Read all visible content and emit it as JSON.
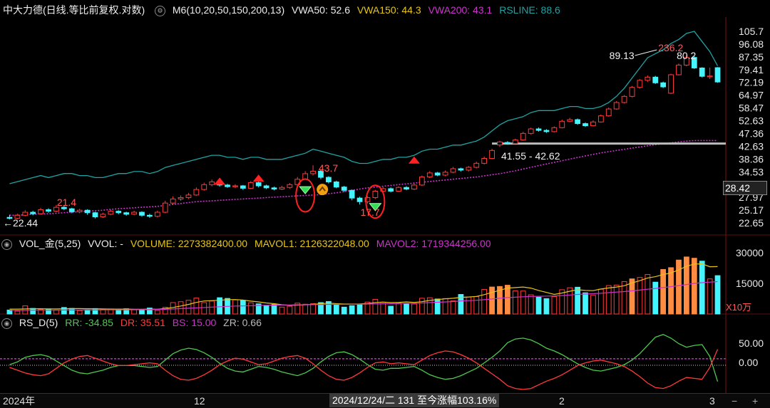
{
  "main": {
    "title": "中大力德(日线.等比前复权.对数)",
    "ma_label": "M6(10,20,50,150,200,13)",
    "vwa50": "VWA50: 52.6",
    "vwa150": "VWA150: 44.3",
    "vwa200": "VWA200: 43.1",
    "rsline": "RSLINE: 88.6",
    "price_ticks": [
      "105.7",
      "96.08",
      "87.35",
      "79.41",
      "72.19",
      "64.97",
      "58.47",
      "52.63",
      "47.36",
      "42.63",
      "38.36",
      "34.53",
      "31.07",
      "27.97",
      "25.17",
      "22.65"
    ],
    "current_price": "28.42",
    "annotations": {
      "low_start": "22.44",
      "a1": "21.4",
      "a2": "43.7",
      "a3": "17.7",
      "zone": "41.55 - 42.62",
      "hi1": "89.13",
      "hi2": "236.2",
      "hi3": "80.2"
    }
  },
  "volume": {
    "title": "VOL_金(5,25)",
    "vvol": "VVOL: -",
    "volume": "VOLUME: 2273382400.00",
    "mavol1": "MAVOL1: 2126322048.00",
    "mavol2": "MAVOL2: 1719344256.00",
    "ticks": [
      "30000",
      "15000"
    ],
    "unit": "X10万"
  },
  "rsd": {
    "title": "RS_D(5)",
    "rr": "RR: -34.85",
    "dr": "DR: 35.51",
    "bs": "BS: 15.00",
    "zr": "ZR: 0.66",
    "ticks": [
      "50.00",
      "0.00"
    ]
  },
  "xaxis": {
    "labels": [
      "2024年",
      "12",
      "2",
      "3"
    ],
    "date_info": "2024/12/24/二 131 至今涨幅103.16%",
    "zoom_minus": "−",
    "zoom_plus": "+"
  },
  "colors": {
    "up": "#ff3b3b",
    "down": "#44f4ff",
    "rsline": "#1fa3a3",
    "vwa": "#cc33cc",
    "yellow": "#e6c619",
    "green": "#4ec94e"
  },
  "chart_data": [
    {
      "type": "candlestick",
      "title": "中大力德(日线.等比前复权.对数)",
      "yscale": "log",
      "ylim": [
        21.5,
        112
      ],
      "candles": [
        [
          22.4,
          22.2,
          22.9,
          22.0
        ],
        [
          22.2,
          22.8,
          23.1,
          22.0
        ],
        [
          22.8,
          23.4,
          23.8,
          22.6
        ],
        [
          23.4,
          23.1,
          23.7,
          22.8
        ],
        [
          23.1,
          23.9,
          24.3,
          22.9
        ],
        [
          23.9,
          23.6,
          24.2,
          23.3
        ],
        [
          23.6,
          24.4,
          24.9,
          23.4
        ],
        [
          24.4,
          24.1,
          24.7,
          23.8
        ],
        [
          24.1,
          23.5,
          24.3,
          23.2
        ],
        [
          23.5,
          23.8,
          24.1,
          23.2
        ],
        [
          23.8,
          23.3,
          24.0,
          22.9
        ],
        [
          23.3,
          22.5,
          23.5,
          22.2
        ],
        [
          22.5,
          23.0,
          23.3,
          22.3
        ],
        [
          23.0,
          23.6,
          23.9,
          22.8
        ],
        [
          23.6,
          23.3,
          23.8,
          23.0
        ],
        [
          23.3,
          23.0,
          23.5,
          22.7
        ],
        [
          23.0,
          23.4,
          23.7,
          22.8
        ],
        [
          23.4,
          22.8,
          23.6,
          22.5
        ],
        [
          22.8,
          22.6,
          23.1,
          22.3
        ],
        [
          22.6,
          23.4,
          23.7,
          22.4
        ],
        [
          23.4,
          25.3,
          25.8,
          23.2
        ],
        [
          25.3,
          26.2,
          26.8,
          25.0
        ],
        [
          26.2,
          26.5,
          27.0,
          25.8
        ],
        [
          26.5,
          27.1,
          27.6,
          26.2
        ],
        [
          27.1,
          28.4,
          28.9,
          26.9
        ],
        [
          28.4,
          29.6,
          30.1,
          28.1
        ],
        [
          29.6,
          30.3,
          30.9,
          29.2
        ],
        [
          30.3,
          29.5,
          30.6,
          29.1
        ],
        [
          29.5,
          29.1,
          29.8,
          28.8
        ],
        [
          29.1,
          29.3,
          29.7,
          28.7
        ],
        [
          29.3,
          28.7,
          29.5,
          28.3
        ],
        [
          28.7,
          30.1,
          30.5,
          28.5
        ],
        [
          30.1,
          29.3,
          30.4,
          28.9
        ],
        [
          29.3,
          28.8,
          29.6,
          28.5
        ],
        [
          28.8,
          28.5,
          29.1,
          28.2
        ],
        [
          28.5,
          28.9,
          29.3,
          28.3
        ],
        [
          28.9,
          29.6,
          30.0,
          28.6
        ],
        [
          29.6,
          31.0,
          31.6,
          29.3
        ],
        [
          31.0,
          32.5,
          33.2,
          30.8
        ],
        [
          32.5,
          33.2,
          34.9,
          32.0
        ],
        [
          33.2,
          31.5,
          33.5,
          31.0
        ],
        [
          31.5,
          30.3,
          31.8,
          29.9
        ],
        [
          30.3,
          29.0,
          30.6,
          28.7
        ],
        [
          29.0,
          28.2,
          29.3,
          27.8
        ],
        [
          28.2,
          26.4,
          28.4,
          25.9
        ],
        [
          26.4,
          25.6,
          26.7,
          25.0
        ],
        [
          25.6,
          26.5,
          26.8,
          25.2
        ],
        [
          26.5,
          28.0,
          28.3,
          26.2
        ],
        [
          28.0,
          28.6,
          29.0,
          27.7
        ],
        [
          28.6,
          28.0,
          28.9,
          27.7
        ],
        [
          28.0,
          28.9,
          29.2,
          27.8
        ],
        [
          28.9,
          28.5,
          29.2,
          28.2
        ],
        [
          28.5,
          29.5,
          30.0,
          28.3
        ],
        [
          29.5,
          31.6,
          32.0,
          29.3
        ],
        [
          31.6,
          32.7,
          33.2,
          31.3
        ],
        [
          32.7,
          32.1,
          33.0,
          31.8
        ],
        [
          32.1,
          32.9,
          33.4,
          31.8
        ],
        [
          32.9,
          33.9,
          34.4,
          32.6
        ],
        [
          33.9,
          33.5,
          34.2,
          33.1
        ],
        [
          33.5,
          34.3,
          34.7,
          33.1
        ],
        [
          34.3,
          35.5,
          36.0,
          34.0
        ],
        [
          35.5,
          37.0,
          37.6,
          35.2
        ],
        [
          37.0,
          39.6,
          40.2,
          36.8
        ],
        [
          41.5,
          42.6,
          43.0,
          40.8
        ],
        [
          42.4,
          42.0,
          42.9,
          41.6
        ],
        [
          42.0,
          43.3,
          43.8,
          41.8
        ],
        [
          43.3,
          45.8,
          46.4,
          43.0
        ],
        [
          45.8,
          47.6,
          48.1,
          45.4
        ],
        [
          47.6,
          47.0,
          48.2,
          46.5
        ],
        [
          47.0,
          46.5,
          47.5,
          46.0
        ],
        [
          46.5,
          48.1,
          48.6,
          46.2
        ],
        [
          48.1,
          50.8,
          51.5,
          47.8
        ],
        [
          50.8,
          51.5,
          52.3,
          50.4
        ],
        [
          51.5,
          49.8,
          52.0,
          49.3
        ],
        [
          49.8,
          48.9,
          50.3,
          48.4
        ],
        [
          48.9,
          50.5,
          51.2,
          48.6
        ],
        [
          50.5,
          53.2,
          53.8,
          50.2
        ],
        [
          53.2,
          56.4,
          57.1,
          52.8
        ],
        [
          56.4,
          59.6,
          60.3,
          56.0
        ],
        [
          59.6,
          62.8,
          63.5,
          59.1
        ],
        [
          62.8,
          67.8,
          68.6,
          62.3
        ],
        [
          67.8,
          72.0,
          72.8,
          67.1
        ],
        [
          72.0,
          74.0,
          75.0,
          71.0
        ],
        [
          74.0,
          70.5,
          74.8,
          69.8
        ],
        [
          70.5,
          68.1,
          71.2,
          67.4
        ],
        [
          64.5,
          75.5,
          76.2,
          64.0
        ],
        [
          75.5,
          82.0,
          83.0,
          75.0
        ],
        [
          82.0,
          87.5,
          89.1,
          81.2
        ],
        [
          87.5,
          80.0,
          88.5,
          79.3
        ],
        [
          80.0,
          74.5,
          80.5,
          73.8
        ],
        [
          74.5,
          74.7,
          80.2,
          72.8
        ],
        [
          80.2,
          71.0,
          80.6,
          70.5
        ]
      ],
      "vwa_series": [
        22.8,
        22.8,
        22.9,
        23.0,
        23.1,
        23.1,
        23.2,
        23.3,
        23.4,
        23.5,
        23.6,
        23.7,
        23.8,
        24.0,
        24.1,
        24.2,
        24.3,
        24.4,
        24.5,
        24.6,
        24.8,
        25.0,
        25.2,
        25.4,
        25.6,
        25.7,
        25.8,
        25.9,
        26.0,
        26.1,
        26.2,
        26.3,
        26.4,
        26.5,
        26.6,
        26.7,
        26.8,
        26.9,
        27.0,
        27.1,
        27.2,
        27.4,
        27.6,
        27.9,
        28.2,
        28.5,
        28.8,
        29.0,
        29.2,
        29.4,
        29.6,
        29.8,
        30.0,
        30.2,
        30.4,
        30.6,
        30.8,
        31.0,
        31.2,
        31.4,
        31.6,
        31.9,
        32.2,
        32.5,
        32.9,
        33.3,
        33.8,
        34.3,
        34.8,
        35.3,
        35.8,
        36.3,
        36.8,
        37.3,
        37.8,
        38.3,
        38.8,
        39.2,
        39.6,
        40.0,
        40.4,
        40.8,
        41.2,
        41.6,
        42.0,
        42.3,
        42.6,
        42.9,
        43.1,
        43.1,
        43.1,
        43.1
      ],
      "rsline_series": [
        32,
        33,
        34,
        35,
        36,
        35,
        36,
        37,
        37,
        36,
        36,
        35,
        35,
        36,
        37,
        37,
        38,
        38,
        37,
        38,
        40,
        41,
        42,
        43,
        44,
        45,
        46,
        46,
        45,
        45,
        44,
        45,
        45,
        44,
        44,
        44,
        45,
        46,
        47,
        49,
        48,
        47,
        46,
        45,
        43,
        42,
        42,
        43,
        44,
        44,
        45,
        45,
        46,
        48,
        49,
        49,
        50,
        51,
        51,
        52,
        53,
        55,
        58,
        61,
        63,
        64,
        65,
        67,
        68,
        68,
        68,
        69,
        70,
        70,
        69,
        69,
        70,
        72,
        75,
        79,
        84,
        89,
        94,
        96,
        98,
        101,
        103,
        106,
        107,
        102,
        97,
        90
      ]
    },
    {
      "type": "bar",
      "title": "VOL_金(5,25)",
      "ylabel": "X10万",
      "ylim": [
        0,
        35000
      ],
      "values": [
        2200,
        1600,
        4500,
        3100,
        2500,
        2800,
        2200,
        3600,
        3100,
        1900,
        2300,
        3000,
        2500,
        2800,
        2600,
        2900,
        2300,
        2300,
        3300,
        2000,
        3700,
        6300,
        6800,
        7600,
        8800,
        6300,
        7200,
        9000,
        8600,
        7800,
        7500,
        6200,
        5600,
        4800,
        5300,
        3800,
        4300,
        6000,
        5400,
        5700,
        6300,
        6900,
        5200,
        3800,
        4600,
        5300,
        6600,
        8100,
        6400,
        4300,
        6100,
        5800,
        5600,
        8700,
        9000,
        8300,
        8500,
        7300,
        10800,
        9400,
        9600,
        13600,
        14900,
        15200,
        15900,
        12800,
        12700,
        10600,
        9300,
        8500,
        9600,
        13400,
        14500,
        14800,
        11700,
        10300,
        13700,
        15700,
        16000,
        17900,
        19400,
        20200,
        21800,
        17600,
        24600,
        25600,
        29800,
        31500,
        30800,
        29200,
        19400,
        21200
      ],
      "mavol1": [
        2700,
        2700,
        2800,
        2900,
        2900,
        2800,
        2800,
        2900,
        3000,
        3000,
        2900,
        2900,
        2800,
        2700,
        2700,
        2700,
        2600,
        2600,
        2700,
        2600,
        3000,
        3600,
        4400,
        5300,
        6400,
        7200,
        7400,
        7600,
        7900,
        8000,
        7700,
        7100,
        6700,
        6100,
        5700,
        5100,
        4800,
        4900,
        5100,
        5300,
        5700,
        6000,
        5700,
        5500,
        5500,
        5600,
        5800,
        6300,
        6600,
        6300,
        6400,
        6700,
        6400,
        6800,
        7500,
        8000,
        8400,
        8700,
        9200,
        9400,
        9700,
        10700,
        11900,
        13100,
        14300,
        14600,
        14900,
        14300,
        13000,
        11900,
        10800,
        11600,
        12600,
        13400,
        13000,
        12900,
        13800,
        14400,
        14900,
        15600,
        17200,
        18400,
        19900,
        20600,
        21800,
        22700,
        24400,
        26400,
        27600,
        27700,
        26100,
        26200
      ],
      "mavol2": [
        2000,
        2000,
        2000,
        2100,
        2100,
        2100,
        2100,
        2200,
        2200,
        2200,
        2200,
        2200,
        2300,
        2300,
        2300,
        2300,
        2400,
        2400,
        2400,
        2500,
        2600,
        2800,
        3000,
        3200,
        3400,
        3600,
        3800,
        4000,
        4200,
        4400,
        4500,
        4600,
        4700,
        4800,
        4900,
        5000,
        5000,
        5100,
        5100,
        5200,
        5200,
        5300,
        5300,
        5300,
        5400,
        5400,
        5500,
        5600,
        5700,
        5700,
        5800,
        5900,
        5900,
        6100,
        6300,
        6500,
        6700,
        6900,
        7200,
        7400,
        7600,
        7900,
        8300,
        8700,
        9100,
        9300,
        9500,
        9700,
        9800,
        9900,
        10000,
        10200,
        10500,
        10800,
        11000,
        11200,
        11500,
        11800,
        12100,
        12400,
        12800,
        13200,
        13700,
        14100,
        14600,
        15100,
        15700,
        16300,
        16900,
        17300,
        17600,
        17900
      ]
    },
    {
      "type": "line",
      "title": "RS_D(5)",
      "ylim": [
        -60,
        80
      ],
      "series": [
        {
          "name": "RR",
          "values": [
            2,
            8,
            18,
            22,
            24,
            20,
            10,
            0,
            -10,
            -16,
            -18,
            -14,
            -10,
            -4,
            0,
            0,
            0,
            -2,
            -4,
            -2,
            12,
            26,
            34,
            38,
            35,
            28,
            18,
            5,
            -6,
            -12,
            -14,
            -8,
            -2,
            -4,
            -8,
            -14,
            -18,
            -22,
            -16,
            -6,
            8,
            20,
            28,
            30,
            24,
            14,
            2,
            -8,
            -10,
            -6,
            -6,
            -4,
            -2,
            -10,
            -20,
            -26,
            -30,
            -28,
            -22,
            -14,
            -6,
            6,
            18,
            32,
            50,
            58,
            60,
            56,
            48,
            38,
            32,
            24,
            14,
            4,
            -4,
            -10,
            -12,
            -8,
            -4,
            2,
            12,
            26,
            44,
            62,
            68,
            60,
            48,
            40,
            44,
            46,
            20,
            -34.85
          ]
        },
        {
          "name": "DR",
          "values": [
            -4,
            -10,
            -16,
            -20,
            -22,
            -18,
            -6,
            6,
            14,
            20,
            22,
            16,
            10,
            4,
            0,
            0,
            2,
            4,
            6,
            4,
            -10,
            -22,
            -30,
            -32,
            -28,
            -20,
            -10,
            2,
            10,
            16,
            14,
            8,
            2,
            4,
            10,
            16,
            20,
            22,
            16,
            4,
            -10,
            -22,
            -30,
            -32,
            -26,
            -16,
            -4,
            6,
            8,
            4,
            6,
            4,
            2,
            12,
            22,
            28,
            32,
            30,
            24,
            16,
            6,
            -6,
            -18,
            -30,
            -44,
            -50,
            -52,
            -50,
            -42,
            -34,
            -28,
            -20,
            -10,
            0,
            6,
            10,
            12,
            8,
            4,
            -2,
            -12,
            -24,
            -38,
            -48,
            -50,
            -44,
            -34,
            -26,
            -28,
            -30,
            -4,
            35.51
          ]
        },
        {
          "name": "BS",
          "values": 15.0,
          "constant": true
        },
        {
          "name": "ZR",
          "values": 0.66,
          "constant": true
        }
      ]
    }
  ]
}
